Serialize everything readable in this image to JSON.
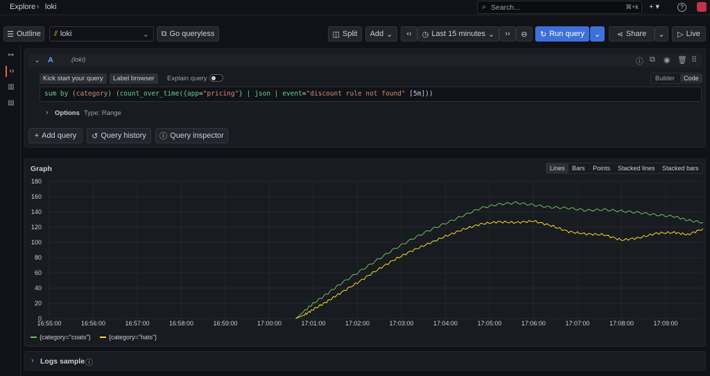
{
  "breadcrumb": {
    "root": "Explore",
    "sep": "›",
    "leaf": "loki"
  },
  "search": {
    "placeholder": "Search...",
    "shortcut": "⌘+k"
  },
  "topbar": {
    "plus": "+ ▾",
    "help": "?"
  },
  "toolbar": {
    "outline": "Outline",
    "datasource": "loki",
    "go_queryless": "Go queryless",
    "split": "Split",
    "add": "Add",
    "time_range": "Last 15 minutes",
    "run_query": "Run query",
    "share": "Share",
    "live": "Live"
  },
  "query": {
    "letter": "A",
    "ds": "(loki)",
    "kickstart": "Kick start your query",
    "label_browser": "Label browser",
    "explain": "Explain query",
    "builder": "Builder",
    "code": "Code",
    "expr_parts": [
      "sum by (",
      "category",
      ") (count_over_time({",
      "app",
      "=",
      "\"pricing\"",
      "} | json | ",
      "event",
      "=",
      "\"discount rule not found\"",
      " [5m]))"
    ],
    "options": "Options",
    "options_type": "Type: Range"
  },
  "actions": {
    "add_query": "Add query",
    "history": "Query history",
    "inspector": "Query inspector"
  },
  "graph": {
    "title": "Graph",
    "modes": [
      "Lines",
      "Bars",
      "Points",
      "Stacked lines",
      "Stacked bars"
    ]
  },
  "logs": {
    "title": "Logs sample"
  },
  "chart_data": {
    "type": "line",
    "x": [
      "16:55:00",
      "16:56:00",
      "16:57:00",
      "16:58:00",
      "16:59:00",
      "17:00:00",
      "17:01:00",
      "17:02:00",
      "17:03:00",
      "17:04:00",
      "17:05:00",
      "17:06:00",
      "17:07:00",
      "17:08:00",
      "17:09:00"
    ],
    "ylim": [
      0,
      180
    ],
    "yticks": [
      0,
      20,
      40,
      60,
      80,
      100,
      120,
      140,
      160,
      180
    ],
    "xrange_minutes": [
      0,
      14.85
    ],
    "legend_placement": "bottom-left",
    "grid": true,
    "series": [
      {
        "name": "{category=\"coats\"}",
        "color": "#73bf69",
        "points": [
          [
            5.6,
            0
          ],
          [
            5.8,
            10
          ],
          [
            6.0,
            20
          ],
          [
            6.3,
            32
          ],
          [
            6.6,
            45
          ],
          [
            7.0,
            60
          ],
          [
            7.4,
            75
          ],
          [
            7.8,
            90
          ],
          [
            8.2,
            103
          ],
          [
            8.6,
            115
          ],
          [
            9.0,
            125
          ],
          [
            9.4,
            135
          ],
          [
            9.8,
            145
          ],
          [
            10.2,
            150
          ],
          [
            10.6,
            152
          ],
          [
            11.0,
            149
          ],
          [
            11.4,
            146
          ],
          [
            11.8,
            145
          ],
          [
            12.2,
            142
          ],
          [
            12.6,
            143
          ],
          [
            13.0,
            141
          ],
          [
            13.4,
            139
          ],
          [
            13.8,
            136
          ],
          [
            14.2,
            134
          ],
          [
            14.5,
            129
          ],
          [
            14.85,
            126
          ]
        ]
      },
      {
        "name": "{category=\"hats\"}",
        "color": "#fade2a",
        "points": [
          [
            5.6,
            0
          ],
          [
            5.8,
            5
          ],
          [
            6.0,
            12
          ],
          [
            6.3,
            22
          ],
          [
            6.6,
            33
          ],
          [
            7.0,
            47
          ],
          [
            7.4,
            62
          ],
          [
            7.8,
            76
          ],
          [
            8.2,
            88
          ],
          [
            8.6,
            98
          ],
          [
            9.0,
            108
          ],
          [
            9.4,
            117
          ],
          [
            9.8,
            124
          ],
          [
            10.2,
            127
          ],
          [
            10.6,
            126
          ],
          [
            11.0,
            128
          ],
          [
            11.4,
            122
          ],
          [
            11.8,
            114
          ],
          [
            12.2,
            111
          ],
          [
            12.6,
            110
          ],
          [
            13.0,
            103
          ],
          [
            13.4,
            106
          ],
          [
            13.8,
            112
          ],
          [
            14.2,
            113
          ],
          [
            14.5,
            110
          ],
          [
            14.85,
            118
          ]
        ]
      }
    ]
  }
}
